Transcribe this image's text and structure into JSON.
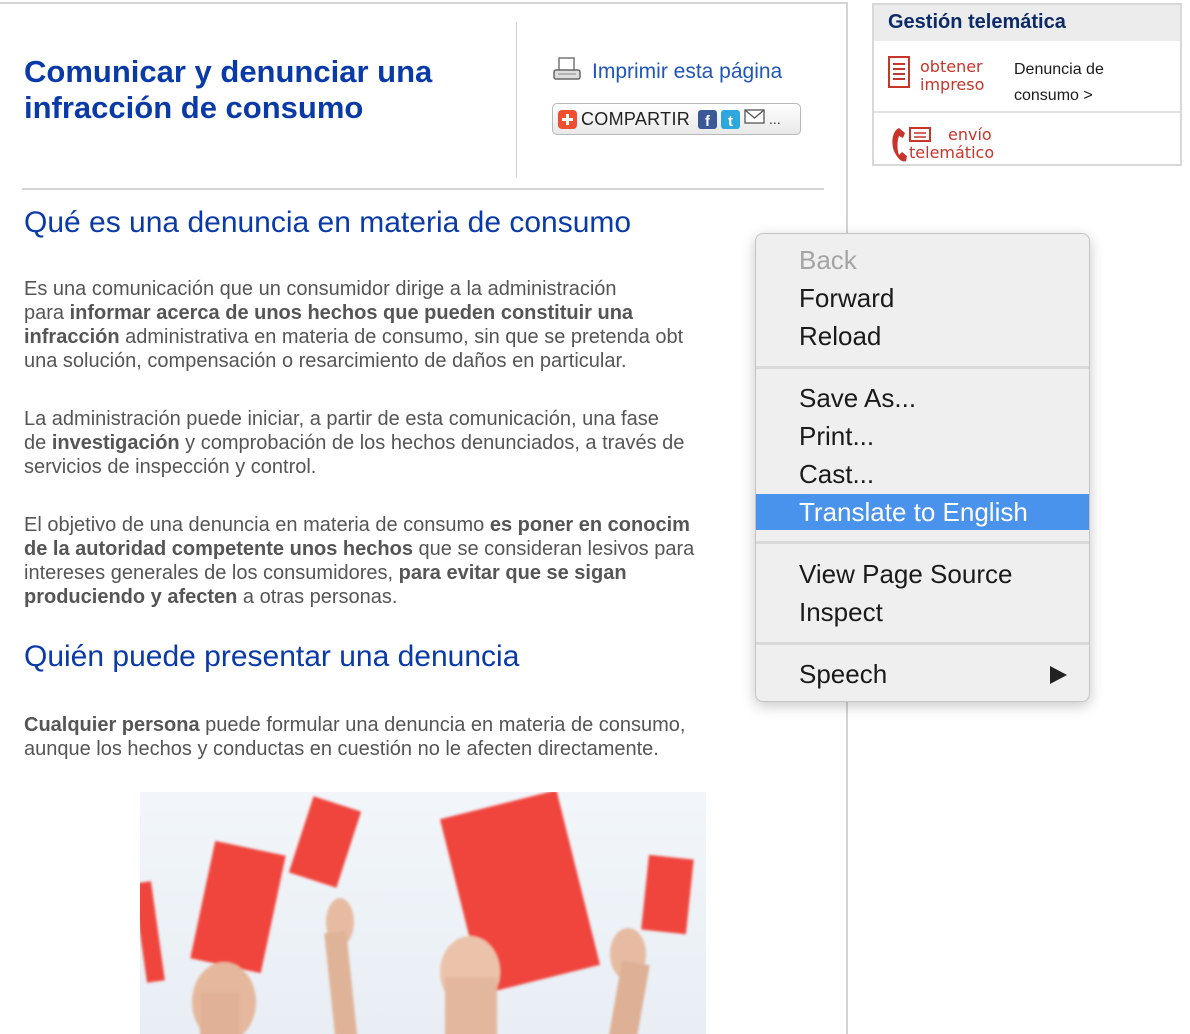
{
  "page": {
    "title": "Comunicar y denunciar una infracción de consumo",
    "print_link": "Imprimir esta página",
    "share_label": "COMPARTIR",
    "share_more": "...",
    "share_icons": [
      "facebook-icon",
      "twitter-icon",
      "email-icon"
    ]
  },
  "sections": [
    {
      "title": "Qué es una denuncia en materia de consumo",
      "paragraphs": [
        {
          "lines": [
            [
              {
                "t": "Es una comunicación que un consumidor dirige a la administración"
              }
            ],
            [
              {
                "t": "para "
              },
              {
                "t": "informar acerca de unos hechos que pueden constituir una",
                "b": true
              }
            ],
            [
              {
                "t": "infracción",
                "b": true
              },
              {
                "t": " administrativa en materia de consumo, sin que se pretenda obt"
              }
            ],
            [
              {
                "t": "una solución, compensación o resarcimiento de daños en particular."
              }
            ]
          ]
        },
        {
          "lines": [
            [
              {
                "t": "La administración puede iniciar, a partir de esta comunicación, una fase"
              }
            ],
            [
              {
                "t": "de "
              },
              {
                "t": "investigación",
                "b": true
              },
              {
                "t": " y comprobación de los hechos denunciados, a través de"
              }
            ],
            [
              {
                "t": "servicios de inspección y control."
              }
            ]
          ]
        },
        {
          "lines": [
            [
              {
                "t": "El objetivo de una denuncia en materia de consumo "
              },
              {
                "t": "es poner en conocim",
                "b": true
              }
            ],
            [
              {
                "t": "de la autoridad competente unos hechos",
                "b": true
              },
              {
                "t": " que se consideran lesivos para"
              }
            ],
            [
              {
                "t": "intereses generales de los consumidores, "
              },
              {
                "t": "para evitar que se sigan",
                "b": true
              }
            ],
            [
              {
                "t": "produciendo y afecten",
                "b": true
              },
              {
                "t": " a otras personas."
              }
            ]
          ]
        }
      ]
    },
    {
      "title": "Quién puede presentar una denuncia",
      "paragraphs": [
        {
          "lines": [
            [
              {
                "t": "Cualquier persona",
                "b": true
              },
              {
                "t": " puede formular una denuncia en materia de consumo,"
              }
            ],
            [
              {
                "t": "aunque los hechos y conductas en cuestión no le afecten directamente."
              }
            ]
          ]
        }
      ]
    }
  ],
  "sidebar": {
    "heading": "Gestión telemática",
    "obtener_line1": "obtener",
    "obtener_line2": "impreso",
    "link_line1": "Denuncia de",
    "link_line2": "consumo >",
    "envio_line1": "envío",
    "envio_line2": "telemático"
  },
  "context_menu": {
    "items": [
      {
        "label": "Back",
        "disabled": true
      },
      {
        "label": "Forward"
      },
      {
        "label": "Reload"
      },
      {
        "label": "Save As..."
      },
      {
        "label": "Print..."
      },
      {
        "label": "Cast..."
      },
      {
        "label": "Translate to English",
        "highlighted": true
      },
      {
        "label": "View Page Source"
      },
      {
        "label": "Inspect"
      },
      {
        "label": "Speech",
        "submenu": true
      }
    ]
  },
  "colors": {
    "link_blue": "#0a3aa8",
    "menu_highlight": "#4a93ec",
    "telematic_red": "#c7342a"
  }
}
